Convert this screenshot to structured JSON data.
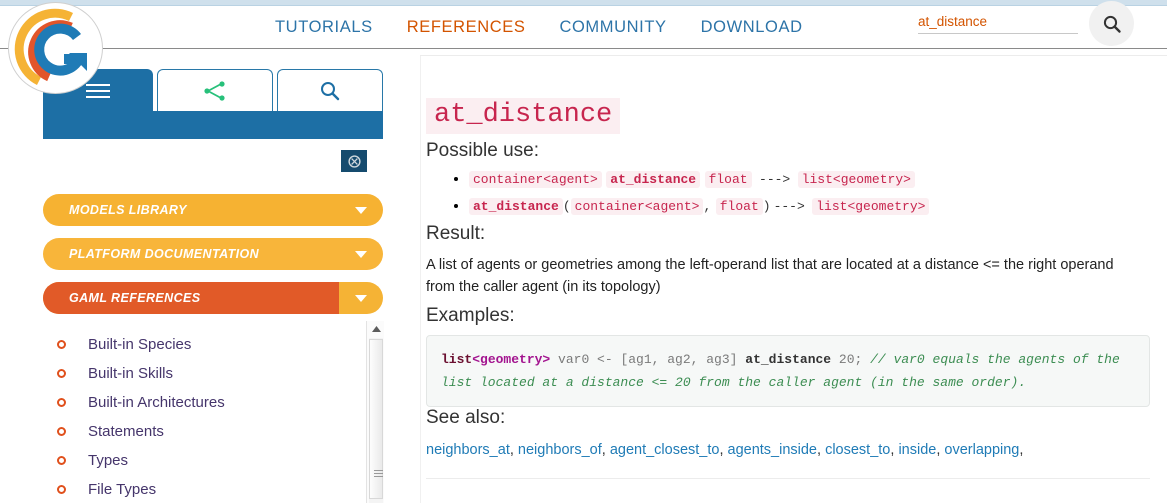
{
  "site": {
    "logo_name": "gama-logo"
  },
  "header": {
    "nav": [
      {
        "label": "TUTORIALS",
        "active": false
      },
      {
        "label": "REFERENCES",
        "active": true
      },
      {
        "label": "COMMUNITY",
        "active": false
      },
      {
        "label": "DOWNLOAD",
        "active": false
      }
    ],
    "search": {
      "value": "at_distance",
      "placeholder": "",
      "button_icon": "search-icon"
    }
  },
  "sidebar": {
    "tabs": [
      {
        "name": "menu-tab",
        "icon": "hamburger-icon",
        "active": true
      },
      {
        "name": "sitemap-tab",
        "icon": "node-graph-icon",
        "active": false
      },
      {
        "name": "search-tab",
        "icon": "search-icon",
        "active": false
      }
    ],
    "collapse_button": {
      "icon": "collapse-icon"
    },
    "accordions": [
      {
        "label": "MODELS LIBRARY",
        "active": false
      },
      {
        "label": "PLATFORM DOCUMENTATION",
        "active": false
      },
      {
        "label": "GAML REFERENCES",
        "active": true
      }
    ],
    "items": [
      {
        "label": "Built-in Species"
      },
      {
        "label": "Built-in Skills"
      },
      {
        "label": "Built-in Architectures"
      },
      {
        "label": "Statements"
      },
      {
        "label": "Types"
      },
      {
        "label": "File Types"
      }
    ],
    "scrollbar": {
      "up_icon": "scroll-up-arrow-icon"
    }
  },
  "main": {
    "title": "at_distance",
    "possible_use_heading": "Possible use:",
    "uses": [
      {
        "parts": [
          {
            "text": "container<agent>",
            "style": "code"
          },
          {
            "text": "at_distance",
            "style": "code-bold"
          },
          {
            "text": "float",
            "style": "code"
          },
          {
            "text": "--->",
            "style": "plain"
          },
          {
            "text": "list<geometry>",
            "style": "code"
          }
        ]
      },
      {
        "parts": [
          {
            "text": "at_distance",
            "style": "code-bold"
          },
          {
            "text": "(",
            "style": "plain-tight"
          },
          {
            "text": "container<agent>",
            "style": "code"
          },
          {
            "text": ",",
            "style": "plain-tight"
          },
          {
            "text": "float",
            "style": "code"
          },
          {
            "text": ")",
            "style": "plain-tight"
          },
          {
            "text": "--->",
            "style": "plain"
          },
          {
            "text": "list<geometry>",
            "style": "code"
          }
        ]
      }
    ],
    "result_heading": "Result:",
    "result_text": "A list of agents or geometries among the left-operand list that are located at a distance <= the right operand from the caller agent (in its topology)",
    "examples_heading": "Examples:",
    "example_code": {
      "tokens": [
        {
          "t": "list",
          "c": "k-type"
        },
        {
          "t": "<geometry>",
          "c": "k-gen"
        },
        {
          "t": " var0 <- [ag1, ag2, ag3] ",
          "c": "k-var"
        },
        {
          "t": "at_distance",
          "c": "k-name"
        },
        {
          "t": " 20;",
          "c": "k-num"
        },
        {
          "t": "  // var0 equals the agents of the list located at a distance <= 20 from the caller agent (in the same order).",
          "c": "k-cmt"
        }
      ],
      "plain": "list<geometry> var0 <- [ag1, ag2, ag3] at_distance 20;  // var0 equals the agents of the list located at a distance <= 20 from the caller agent (in the same order)."
    },
    "see_also_heading": "See also:",
    "see_also": [
      "neighbors_at",
      "neighbors_of",
      "agent_closest_to",
      "agents_inside",
      "closest_to",
      "inside",
      "overlapping"
    ]
  },
  "colors": {
    "brand_blue": "#1d6fa5",
    "brand_orange": "#e15a28",
    "accent_yellow": "#f6b232",
    "link_blue": "#1f7bb6",
    "code_pink": "#c7254e",
    "list_text": "#45356b"
  }
}
